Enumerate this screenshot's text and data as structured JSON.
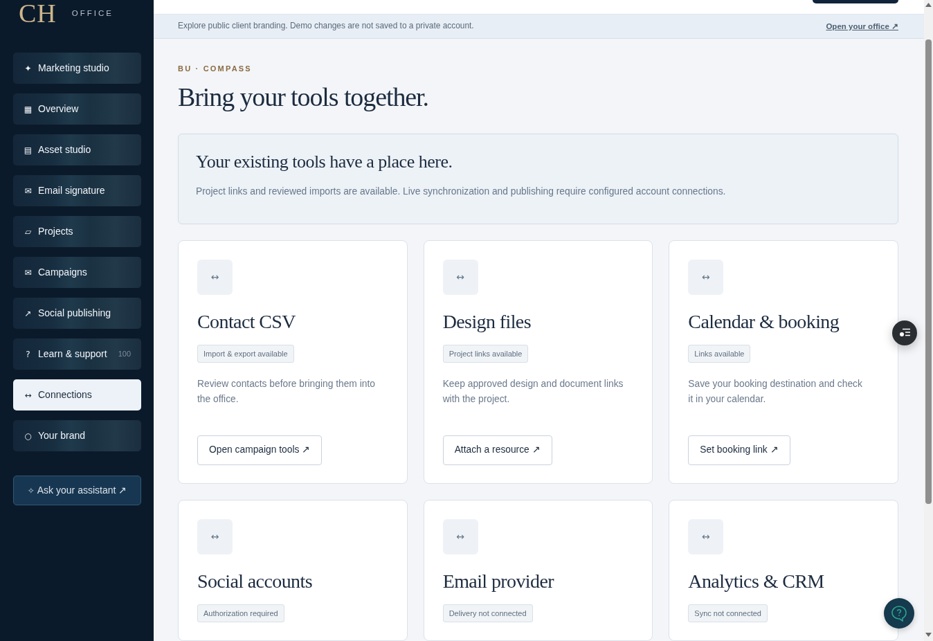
{
  "logo": {
    "monogram": "CH",
    "subtitle": "OFFICE"
  },
  "sidebar": {
    "items": [
      {
        "icon": "✦",
        "label": "Marketing studio",
        "selected": false
      },
      {
        "icon": "▦",
        "label": "Overview",
        "selected": false
      },
      {
        "icon": "▤",
        "label": "Asset studio",
        "selected": false
      },
      {
        "icon": "✉",
        "label": "Email signature",
        "selected": false
      },
      {
        "icon": "▱",
        "label": "Projects",
        "selected": false
      },
      {
        "icon": "✉",
        "label": "Campaigns",
        "selected": false
      },
      {
        "icon": "↗",
        "label": "Social publishing",
        "selected": false
      },
      {
        "icon": "?",
        "label": "Learn & support",
        "count": "100",
        "selected": false
      },
      {
        "icon": "↔",
        "label": "Connections",
        "selected": true
      },
      {
        "icon": "○",
        "label": "Your brand",
        "selected": false
      }
    ],
    "assistant_button": {
      "icon": "✧",
      "label": "Ask your assistant ↗"
    }
  },
  "banner": {
    "text": "Explore public client branding. Demo changes are not saved to a private account.",
    "link": "Open your office ↗"
  },
  "page": {
    "eyebrow": "BU · COMPASS",
    "title": "Bring your tools together."
  },
  "notice": {
    "title": "Your existing tools have a place here.",
    "text": "Project links and reviewed imports are available. Live synchronization and publishing require configured account connections."
  },
  "cards": [
    {
      "icon": "↔",
      "title": "Contact CSV",
      "status": "Import & export available",
      "description": "Review contacts before bringing them into the office.",
      "action": "Open campaign tools ↗"
    },
    {
      "icon": "↔",
      "title": "Design files",
      "status": "Project links available",
      "description": "Keep approved design and document links with the project.",
      "action": "Attach a resource ↗"
    },
    {
      "icon": "↔",
      "title": "Calendar & booking",
      "status": "Links available",
      "description": "Save your booking destination and check it in your calendar.",
      "action": "Set booking link ↗"
    },
    {
      "icon": "↔",
      "title": "Social accounts",
      "status": "Authorization required"
    },
    {
      "icon": "↔",
      "title": "Email provider",
      "status": "Delivery not connected"
    },
    {
      "icon": "↔",
      "title": "Analytics & CRM",
      "status": "Sync not connected"
    }
  ]
}
